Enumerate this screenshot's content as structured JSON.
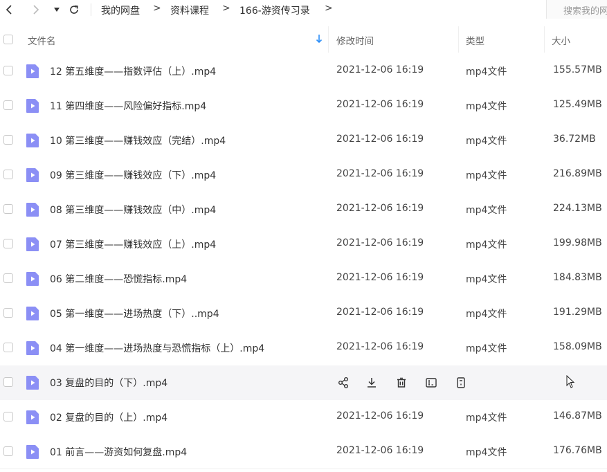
{
  "breadcrumb": {
    "items": [
      "我的网盘",
      "资料课程",
      "166-游资传习录"
    ],
    "separator": ">"
  },
  "search": {
    "placeholder": "搜索我的网"
  },
  "columns": {
    "name": "文件名",
    "modified": "修改时间",
    "type": "类型",
    "size": "大小"
  },
  "files": [
    {
      "name": "12 第五维度——指数评估（上）.mp4",
      "modified": "2021-12-06 16:19",
      "type": "mp4文件",
      "size": "155.57MB"
    },
    {
      "name": "11 第四维度——风险偏好指标.mp4",
      "modified": "2021-12-06 16:19",
      "type": "mp4文件",
      "size": "125.49MB"
    },
    {
      "name": "10 第三维度——赚钱效应（完结）.mp4",
      "modified": "2021-12-06 16:19",
      "type": "mp4文件",
      "size": "36.72MB"
    },
    {
      "name": "09 第三维度——赚钱效应（下）.mp4",
      "modified": "2021-12-06 16:19",
      "type": "mp4文件",
      "size": "216.89MB"
    },
    {
      "name": "08 第三维度——赚钱效应（中）.mp4",
      "modified": "2021-12-06 16:19",
      "type": "mp4文件",
      "size": "224.13MB"
    },
    {
      "name": "07 第三维度——赚钱效应（上）.mp4",
      "modified": "2021-12-06 16:19",
      "type": "mp4文件",
      "size": "199.98MB"
    },
    {
      "name": "06 第二维度——恐慌指标.mp4",
      "modified": "2021-12-06 16:19",
      "type": "mp4文件",
      "size": "184.83MB"
    },
    {
      "name": "05 第一维度——进场热度（下）..mp4",
      "modified": "2021-12-06 16:19",
      "type": "mp4文件",
      "size": "191.29MB"
    },
    {
      "name": "04 第一维度——进场热度与恐慌指标（上）.mp4",
      "modified": "2021-12-06 16:19",
      "type": "mp4文件",
      "size": "158.09MB"
    },
    {
      "name": "03 复盘的目的（下）.mp4",
      "modified": "",
      "type": "",
      "size": "",
      "hovered": true
    },
    {
      "name": "02 复盘的目的（上）.mp4",
      "modified": "2021-12-06 16:19",
      "type": "mp4文件",
      "size": "146.87MB"
    },
    {
      "name": "01 前言——游资如何复盘.mp4",
      "modified": "2021-12-06 16:19",
      "type": "mp4文件",
      "size": "176.76MB"
    }
  ],
  "row_actions": [
    "share-icon",
    "download-icon",
    "delete-icon",
    "rename-icon",
    "more-icon"
  ],
  "colors": {
    "file_icon": "#8b8ff5",
    "hover_row": "#f5f5f7",
    "sort_arrow": "#2b8ef8"
  }
}
